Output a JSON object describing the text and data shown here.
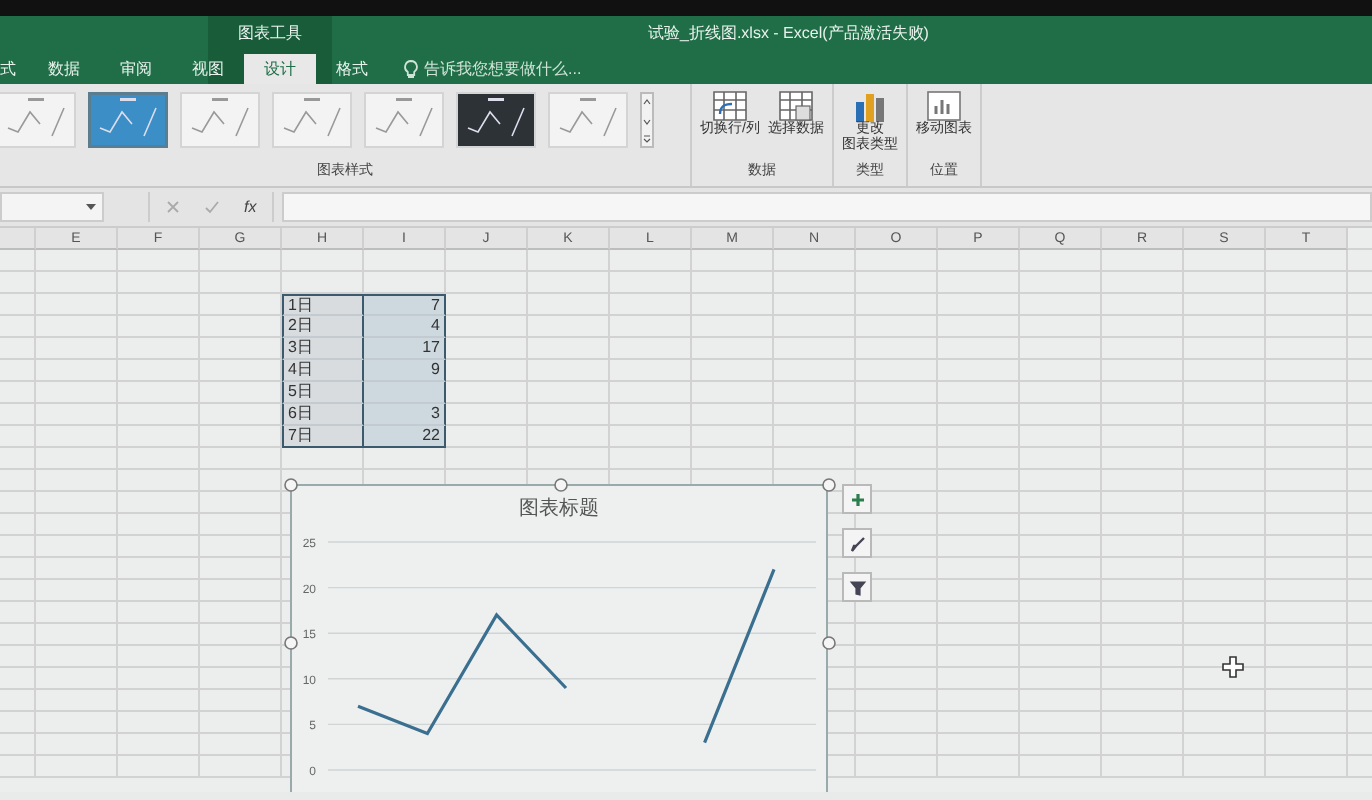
{
  "window": {
    "title": "试验_折线图.xlsx - Excel(产品激活失败)",
    "contextual_group": "图表工具"
  },
  "tabs": [
    {
      "label": "式",
      "selected": false
    },
    {
      "label": "数据",
      "selected": false
    },
    {
      "label": "审阅",
      "selected": false
    },
    {
      "label": "视图",
      "selected": false
    },
    {
      "label": "设计",
      "selected": true
    },
    {
      "label": "格式",
      "selected": false
    }
  ],
  "tell_me": {
    "placeholder": "告诉我您想要做什么..."
  },
  "ribbon": {
    "chart_styles": {
      "label": "图表样式",
      "styles": [
        {
          "kind": "light",
          "selected": false
        },
        {
          "kind": "blue",
          "selected": true
        },
        {
          "kind": "light",
          "selected": false
        },
        {
          "kind": "light",
          "selected": false
        },
        {
          "kind": "light",
          "selected": false
        },
        {
          "kind": "dark",
          "selected": false
        },
        {
          "kind": "light",
          "selected": false
        }
      ]
    },
    "groups": [
      {
        "label": "数据",
        "buttons": [
          {
            "kind": "switch",
            "label": "切换行/列"
          },
          {
            "kind": "select",
            "label": "选择数据"
          }
        ]
      },
      {
        "label": "类型",
        "buttons": [
          {
            "kind": "type",
            "lines": [
              "更改",
              "图表类型"
            ]
          }
        ]
      },
      {
        "label": "位置",
        "buttons": [
          {
            "kind": "move",
            "label": "移动图表"
          }
        ]
      }
    ]
  },
  "formula_bar": {
    "function_label": "fx"
  },
  "columns": [
    "E",
    "F",
    "G",
    "H",
    "I",
    "J",
    "K",
    "L",
    "M",
    "N",
    "O",
    "P",
    "Q",
    "R",
    "S",
    "T"
  ],
  "data_range": {
    "rows": [
      [
        "1日",
        "7"
      ],
      [
        "2日",
        "4"
      ],
      [
        "3日",
        "17"
      ],
      [
        "4日",
        "9"
      ],
      [
        "5日",
        ""
      ],
      [
        "6日",
        "3"
      ],
      [
        "7日",
        "22"
      ]
    ]
  },
  "chart": {
    "chart_data": {
      "type": "line",
      "title": "图表标题",
      "grid": true,
      "series": [
        {
          "color": "#3a6f8f",
          "values": [
            7,
            4,
            17,
            9,
            null,
            3,
            22
          ]
        }
      ],
      "ylim": [
        0,
        25
      ],
      "yticks": [
        0,
        5,
        10,
        15,
        20,
        25
      ]
    }
  }
}
